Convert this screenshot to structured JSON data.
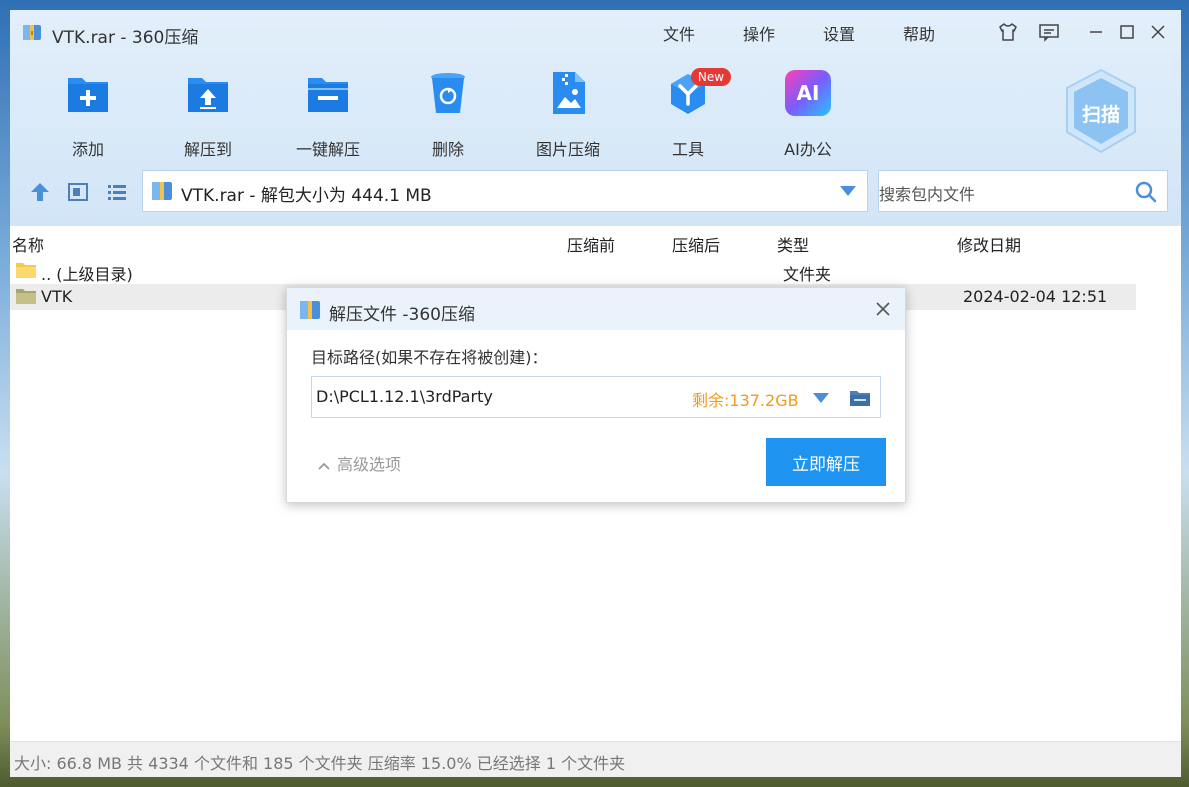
{
  "window": {
    "title": "VTK.rar - 360压缩",
    "menu": [
      "文件",
      "操作",
      "设置",
      "帮助"
    ]
  },
  "toolbar": {
    "items": [
      {
        "label": "添加",
        "icon": "add-folder-icon"
      },
      {
        "label": "解压到",
        "icon": "extract-to-icon"
      },
      {
        "label": "一键解压",
        "icon": "one-click-extract-icon"
      },
      {
        "label": "删除",
        "icon": "delete-icon"
      },
      {
        "label": "图片压缩",
        "icon": "image-compress-icon"
      },
      {
        "label": "工具",
        "icon": "tools-icon",
        "badge": "New"
      },
      {
        "label": "AI办公",
        "icon": "ai-office-icon",
        "icon_text": "AI"
      }
    ],
    "scan_label": "扫描"
  },
  "nav": {
    "address": "VTK.rar - 解包大小为 444.1 MB",
    "search_placeholder": "搜索包内文件"
  },
  "file_list": {
    "columns": {
      "name": "名称",
      "before": "压缩前",
      "after": "压缩后",
      "type": "类型",
      "modified": "修改日期"
    },
    "rows": [
      {
        "name": ".. (上级目录)",
        "type": "文件夹",
        "modified": ""
      },
      {
        "name": "VTK",
        "type": "",
        "modified": "2024-02-04 12:51"
      }
    ]
  },
  "status": {
    "text": "大小: 66.8 MB 共 4334 个文件和 185 个文件夹 压缩率 15.0% 已经选择 1 个文件夹"
  },
  "dialog": {
    "title": "解压文件 -360压缩",
    "label": "目标路径(如果不存在将被创建)：",
    "path": "D:\\PCL1.12.1\\3rdParty",
    "free_space": "剩余:137.2GB",
    "advanced": "高级选项",
    "confirm": "立即解压"
  },
  "colors": {
    "accent": "#1e93ef",
    "free_space": "#f29a1a",
    "badge": "#e53935"
  }
}
